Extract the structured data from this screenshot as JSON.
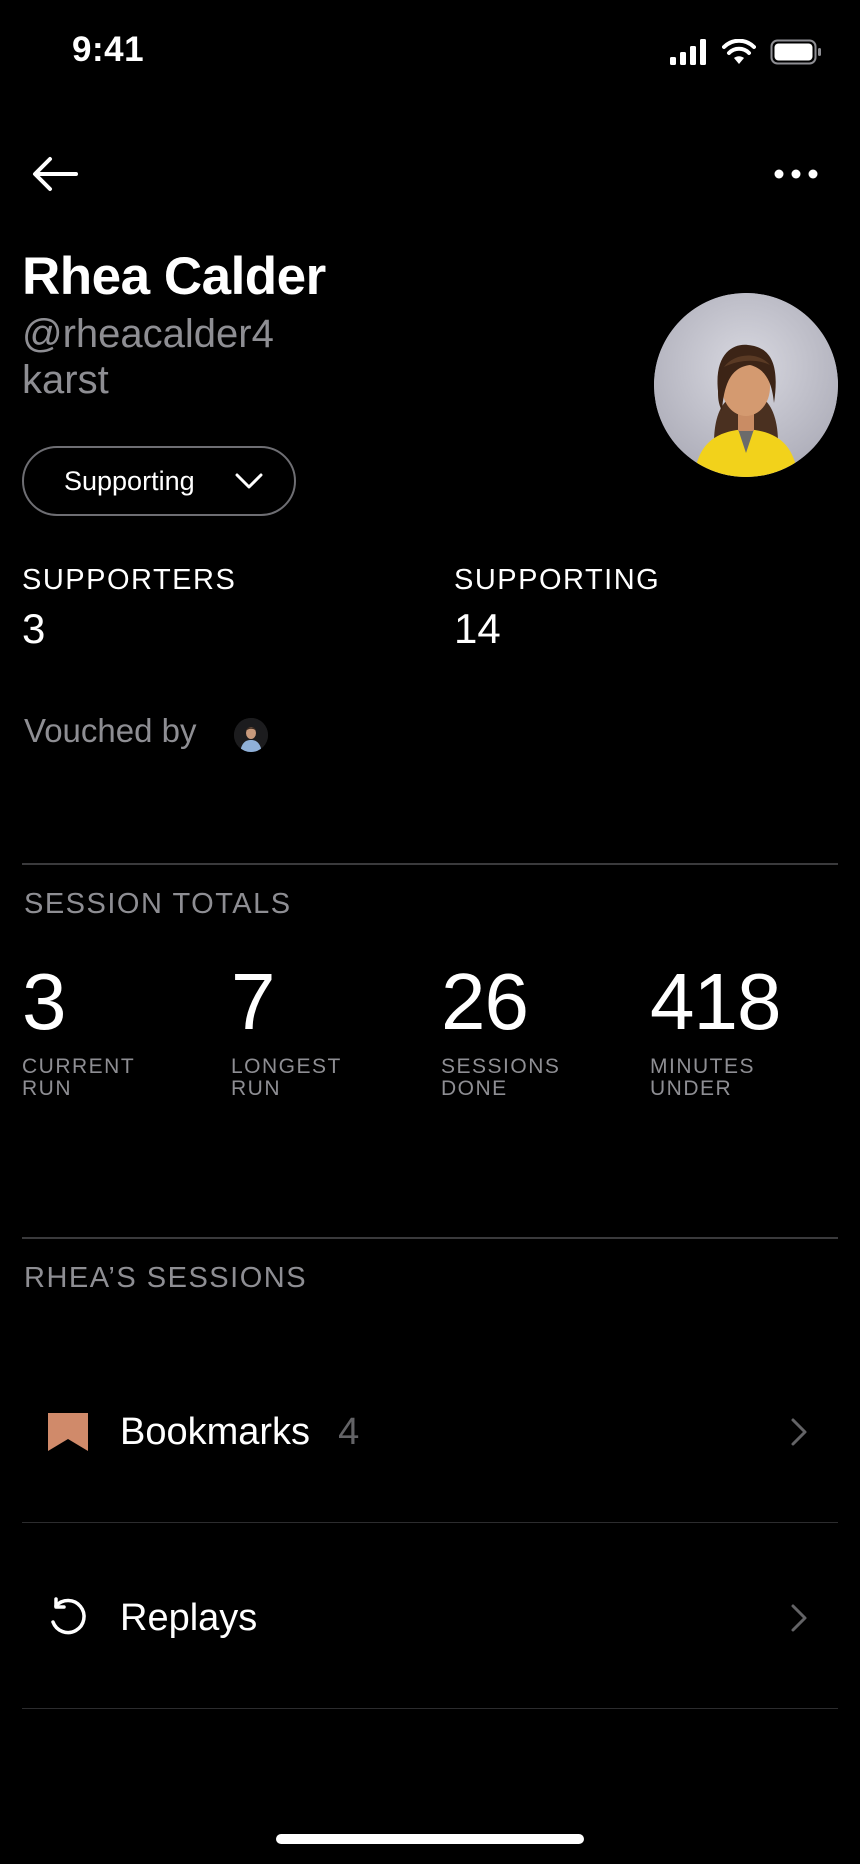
{
  "status_bar": {
    "time": "9:41"
  },
  "profile": {
    "name": "Rhea Calder",
    "handle": "@rheacalder4",
    "community": "karst",
    "support_button_label": "Supporting"
  },
  "stats": [
    {
      "label": "SUPPORTERS",
      "value": "3"
    },
    {
      "label": "SUPPORTING",
      "value": "14"
    }
  ],
  "vouched": {
    "label": "Vouched by"
  },
  "session_totals": {
    "title": "SESSION TOTALS",
    "items": [
      {
        "value": "3",
        "label_line1": "CURRENT",
        "label_line2": "RUN"
      },
      {
        "value": "7",
        "label_line1": "LONGEST",
        "label_line2": "RUN"
      },
      {
        "value": "26",
        "label_line1": "SESSIONS",
        "label_line2": "DONE"
      },
      {
        "value": "418",
        "label_line1": "MINUTES",
        "label_line2": "UNDER"
      }
    ]
  },
  "sessions": {
    "title": "RHEA’S SESSIONS",
    "rows": [
      {
        "label": "Bookmarks",
        "count": "4",
        "icon": "bookmark-icon"
      },
      {
        "label": "Replays",
        "icon": "replay-icon"
      }
    ]
  },
  "colors": {
    "background": "#000000",
    "secondary_text": "#8e8e93",
    "bookmark_accent": "#d08a6a",
    "avatar_jacket": "#f2d21b"
  }
}
